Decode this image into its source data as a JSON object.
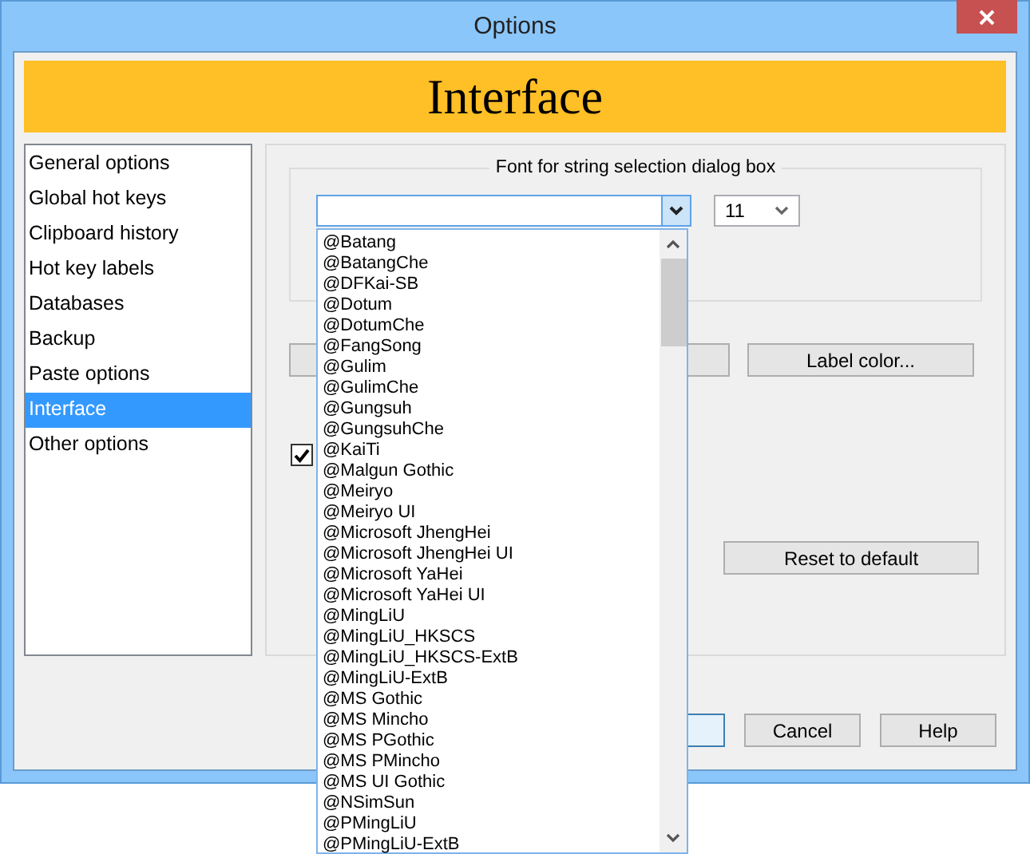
{
  "window": {
    "title": "Options"
  },
  "banner": {
    "title": "Interface"
  },
  "sidebar": {
    "items": [
      {
        "label": "General options",
        "selected": false
      },
      {
        "label": "Global hot keys",
        "selected": false
      },
      {
        "label": "Clipboard history",
        "selected": false
      },
      {
        "label": "Hot key labels",
        "selected": false
      },
      {
        "label": "Databases",
        "selected": false
      },
      {
        "label": "Backup",
        "selected": false
      },
      {
        "label": "Paste options",
        "selected": false
      },
      {
        "label": "Interface",
        "selected": true
      },
      {
        "label": "Other options",
        "selected": false
      }
    ]
  },
  "font_group": {
    "title": "Font for string selection dialog box",
    "font_combo": {
      "expanded": true,
      "options": [
        "@Batang",
        "@BatangChe",
        "@DFKai-SB",
        "@Dotum",
        "@DotumChe",
        "@FangSong",
        "@Gulim",
        "@GulimChe",
        "@Gungsuh",
        "@GungsuhChe",
        "@KaiTi",
        "@Malgun Gothic",
        "@Meiryo",
        "@Meiryo UI",
        "@Microsoft JhengHei",
        "@Microsoft JhengHei UI",
        "@Microsoft YaHei",
        "@Microsoft YaHei UI",
        "@MingLiU",
        "@MingLiU_HKSCS",
        "@MingLiU_HKSCS-ExtB",
        "@MingLiU-ExtB",
        "@MS Gothic",
        "@MS Mincho",
        "@MS PGothic",
        "@MS PMincho",
        "@MS UI Gothic",
        "@NSimSun",
        "@PMingLiU",
        "@PMingLiU-ExtB"
      ]
    },
    "size_combo": {
      "value": "11"
    }
  },
  "label_color_button": "Label color...",
  "checkbox": {
    "checked": true
  },
  "reset_button": "Reset to default",
  "footer_buttons": [
    "Cancel",
    "Help"
  ]
}
